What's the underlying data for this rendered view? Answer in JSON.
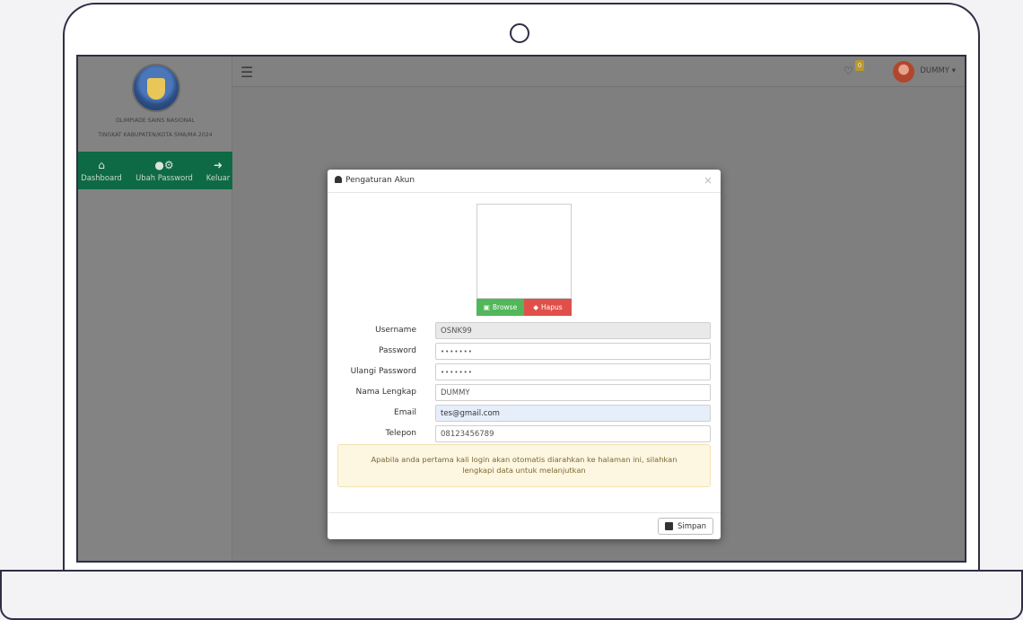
{
  "sidebar": {
    "brand_line1": "OLIMPIADE SAINS NASIONAL",
    "brand_line2": "TINGKAT KABUPATEN/KOTA SMA/MA 2024",
    "nav": [
      {
        "label": "Dashboard",
        "icon": "home-icon"
      },
      {
        "label": "Ubah Password",
        "icon": "user-gear-icon"
      },
      {
        "label": "Keluar",
        "icon": "sign-out-icon"
      }
    ]
  },
  "topbar": {
    "notification_count": "0",
    "user_name": "DUMMY"
  },
  "modal": {
    "title": "Pengaturan Akun",
    "close": "×",
    "browse_label": "Browse",
    "hapus_label": "Hapus",
    "fields": {
      "username": {
        "label": "Username",
        "value": "OSNK99"
      },
      "password": {
        "label": "Password",
        "value": "•••••••"
      },
      "ulangi_password": {
        "label": "Ulangi Password",
        "value": "•••••••"
      },
      "nama_lengkap": {
        "label": "Nama Lengkap",
        "value": "DUMMY"
      },
      "email": {
        "label": "Email",
        "value": "tes@gmail.com"
      },
      "telepon": {
        "label": "Telepon",
        "value": "08123456789"
      }
    },
    "alert": "Apabila anda pertama kali login akan otomatis diarahkan ke halaman ini, silahkan lengkapi data untuk melanjutkan",
    "save_label": "Simpan"
  },
  "colors": {
    "nav_bg": "#0e6a44",
    "browse_bg": "#52b75a",
    "hapus_bg": "#e0504b",
    "alert_bg": "#fdf6e1"
  }
}
